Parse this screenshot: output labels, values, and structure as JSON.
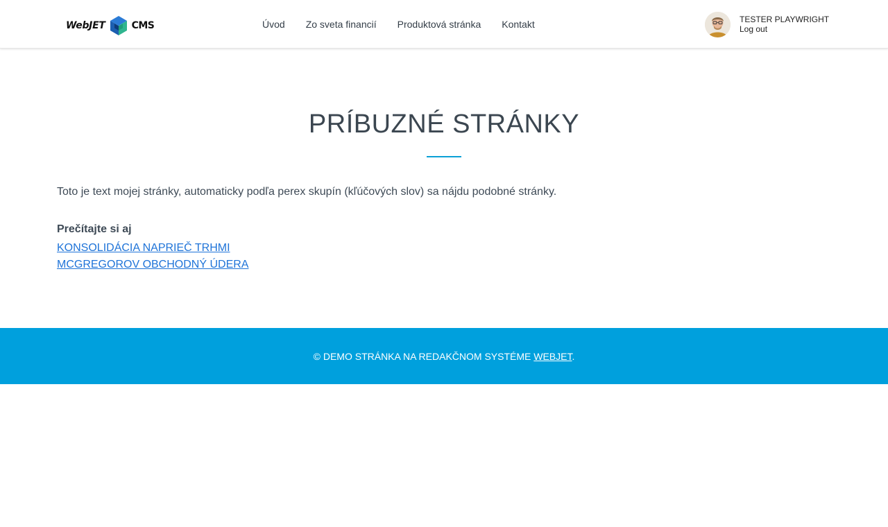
{
  "header": {
    "logo": {
      "left_text": "WebJET",
      "right_text": "CMS"
    },
    "nav": [
      {
        "label": "Úvod"
      },
      {
        "label": "Zo sveta financií"
      },
      {
        "label": "Produktová stránka"
      },
      {
        "label": "Kontakt"
      }
    ],
    "user": {
      "name": "TESTER PLAYWRIGHT",
      "logout_label": "Log out"
    }
  },
  "main": {
    "title": "PRÍBUZNÉ STRÁNKY",
    "intro": "Toto je text mojej stránky, automaticky podľa perex skupín (kľúčových slov) sa nájdu podobné stránky.",
    "related_heading": "Prečítajte si aj",
    "related_links": [
      {
        "label": "KONSOLIDÁCIA NAPRIEČ TRHMI"
      },
      {
        "label": "MCGREGOROV OBCHODNÝ ÚDERA"
      }
    ]
  },
  "footer": {
    "prefix": "© DEMO STRÁNKA NA REDAKČNOM SYSTÉME ",
    "link_label": "WEBJET",
    "suffix": "."
  },
  "colors": {
    "accent": "#00a0dd",
    "link": "#1e73d8",
    "heading": "#3b4650"
  }
}
